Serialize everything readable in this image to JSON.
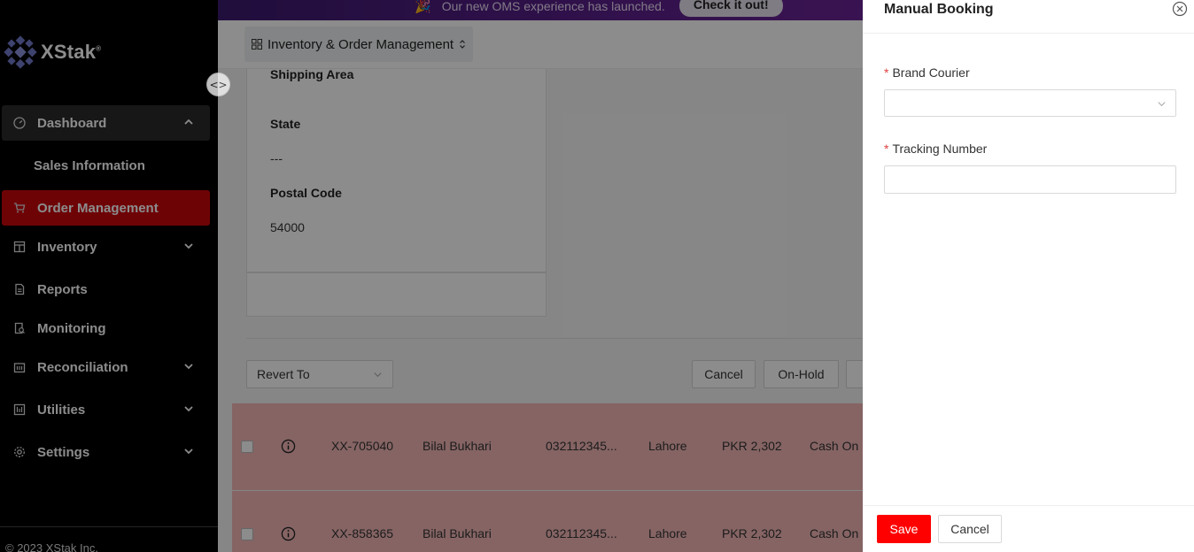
{
  "banner": {
    "emoji": "🎉",
    "text": "Our new OMS experience has launched.",
    "button_label": "Check it out!"
  },
  "sidebar": {
    "logo_text": "XStak",
    "logo_mark": "®",
    "collapse_glyph": "<>",
    "items": [
      {
        "label": "Dashboard",
        "icon": "gauge-icon"
      },
      {
        "label": "Sales Information"
      },
      {
        "label": "Order Management",
        "icon": "cart-icon"
      },
      {
        "label": "Inventory",
        "icon": "inventory-icon"
      },
      {
        "label": "Reports",
        "icon": "report-icon"
      },
      {
        "label": "Monitoring",
        "icon": "monitoring-icon"
      },
      {
        "label": "Reconciliation",
        "icon": "reconciliation-icon"
      },
      {
        "label": "Utilities",
        "icon": "utilities-icon"
      },
      {
        "label": "Settings",
        "icon": "gear-icon"
      }
    ],
    "copyright": "© 2023 XStak Inc."
  },
  "topbar": {
    "module_label": "Inventory & Order Management"
  },
  "address_card": {
    "shipping_area_label": "Shipping Area",
    "state_label": "State",
    "state_value": "---",
    "postal_code_label": "Postal Code",
    "postal_code_value": "54000"
  },
  "actions": {
    "revert_placeholder": "Revert To",
    "cancel_label": "Cancel",
    "onhold_label": "On-Hold"
  },
  "orders": [
    {
      "id": "XX-705040",
      "customer": "Bilal Bukhari",
      "phone": "032112345...",
      "city": "Lahore",
      "amount": "PKR 2,302",
      "payment": "Cash On D"
    },
    {
      "id": "XX-858365",
      "customer": "Bilal Bukhari",
      "phone": "032112345...",
      "city": "Lahore",
      "amount": "PKR 2,302",
      "payment": "Cash On D"
    }
  ],
  "drawer": {
    "title": "Manual Booking",
    "brand_courier_label": "Brand Courier",
    "tracking_number_label": "Tracking Number",
    "required_mark": "*",
    "save_label": "Save",
    "cancel_label": "Cancel"
  },
  "colors": {
    "accent_red": "#c8070c",
    "save_red": "#ff0000",
    "row_highlight": "#f5b7b7"
  }
}
